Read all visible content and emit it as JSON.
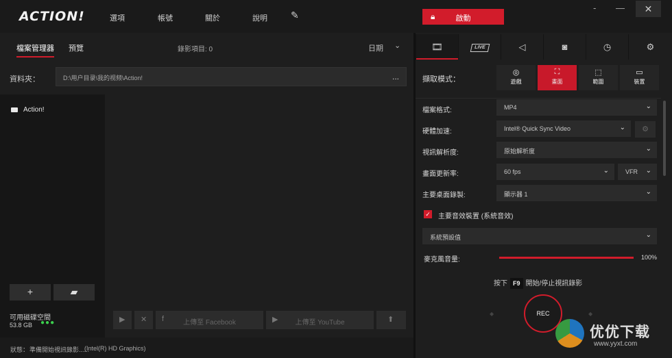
{
  "app": {
    "logo": "ACTION!",
    "menu": [
      "選項",
      "帳號",
      "關於",
      "說明"
    ],
    "activate_label": "啟動",
    "window_controls": {
      "minimize": "-",
      "maximize": "—",
      "close": "✕"
    }
  },
  "left_panel": {
    "tabs": [
      {
        "label": "檔案管理器",
        "active": true
      },
      {
        "label": "預覽",
        "active": false
      }
    ],
    "recording_count": "錄影項目: 0",
    "sort_label": "日期",
    "folder_label": "資料夾：",
    "folder_path": "D:\\用户目录\\我的视频\\Action!",
    "folder_more": "...",
    "tree_items": [
      "Action!"
    ],
    "add_button": "+",
    "disk_label": "可用磁碟空間",
    "disk_size": "53.8 GB",
    "disk_status": "●●●",
    "upload_facebook": "上傳至 Facebook",
    "upload_youtube": "上傳至 YouTube"
  },
  "status_bar": {
    "label": "狀態：",
    "text": "準備開始視訊錄影......",
    "gpu": "(Intel(R) HD Graphics)"
  },
  "right_panel": {
    "tabs": [
      {
        "name": "video-tab-icon",
        "active": true
      },
      {
        "name": "live-tab-icon",
        "badge": "LIVE"
      },
      {
        "name": "audio-tab-icon"
      },
      {
        "name": "camera-tab-icon"
      },
      {
        "name": "timer-tab-icon"
      },
      {
        "name": "settings-tab-icon"
      }
    ],
    "capture_mode_label": "擷取模式：",
    "capture_modes": [
      {
        "label": "遊戲",
        "icon": "gamepad-icon",
        "selected": false
      },
      {
        "label": "畫面",
        "icon": "fullscreen-icon",
        "selected": true
      },
      {
        "label": "範圍",
        "icon": "region-icon",
        "selected": false
      },
      {
        "label": "裝置",
        "icon": "device-icon",
        "selected": false
      }
    ],
    "settings": {
      "file_format_label": "檔案格式:",
      "file_format_value": "MP4",
      "hw_accel_label": "硬體加速:",
      "hw_accel_value": "Intel® Quick Sync Video",
      "resolution_label": "視訊解析度:",
      "resolution_value": "原始解析度",
      "framerate_label": "畫面更新率:",
      "framerate_value": "60 fps",
      "framerate_mode": "VFR",
      "desktop_label": "主要桌面錄製:",
      "desktop_value": "顯示器 1",
      "audio_device_label": "主要音效裝置 (系統音效)",
      "audio_device_checked": true,
      "audio_device_value": "系統預設值",
      "mic_label": "麥克風音量:",
      "mic_percent": "100%",
      "mic_level": 1.0
    },
    "hotkey_prefix": "按下",
    "hotkey_key": "F9",
    "hotkey_suffix": "開始/停止視訊錄影",
    "rec_label": "REC"
  },
  "watermark": {
    "text": "优优下载",
    "url": "www.yyxt.com"
  },
  "colors": {
    "accent": "#d21c2b",
    "background": "#1e1e1e",
    "disk_ok": "#3cd04e"
  }
}
